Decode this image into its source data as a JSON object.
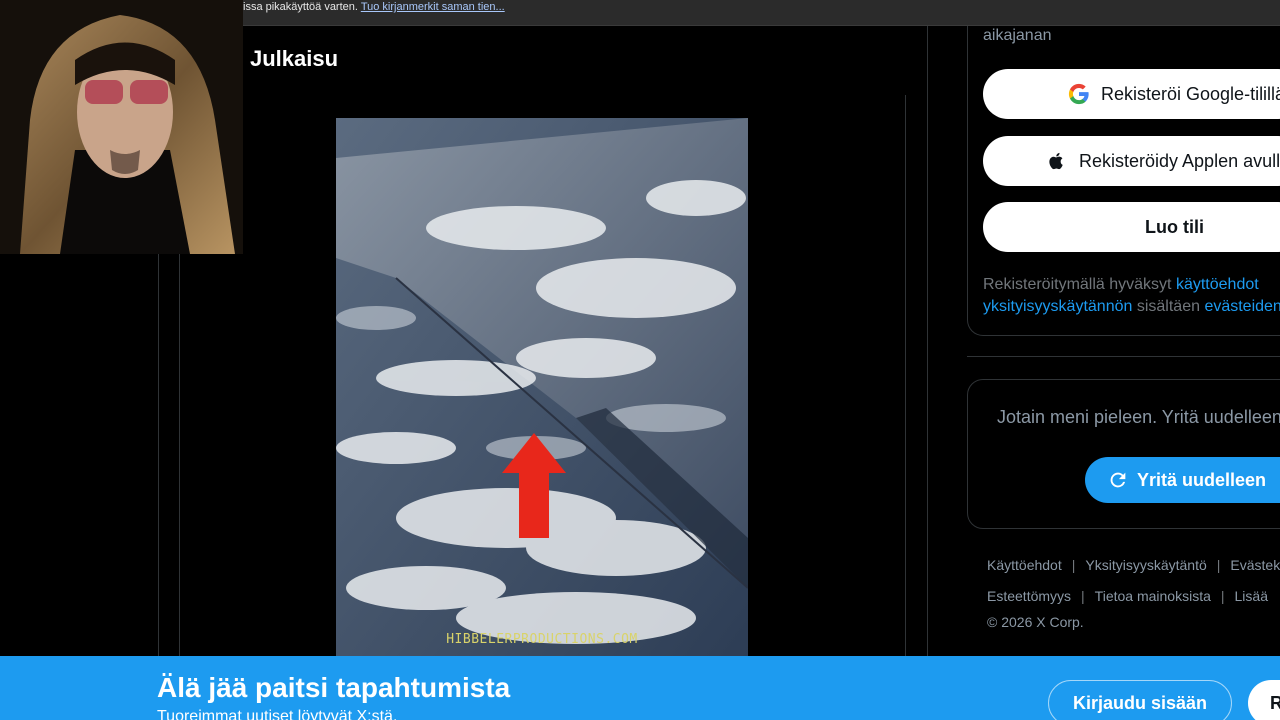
{
  "bookmark_bar": {
    "text": "issa pikakäyttöä varten. ",
    "link": "Tuo kirjanmerkit saman tien..."
  },
  "post": {
    "title": "Julkaisu",
    "media_watermark": "HIBBELERPRODUCTIONS.COM"
  },
  "sidebar": {
    "timeline_fragment": "aikajanan",
    "google_button": "Rekisteröi Google-tilillä",
    "apple_button": "Rekisteröidy Applen avulla",
    "create_account_button": "Luo tili",
    "terms": {
      "prefix": "Rekisteröitymällä hyväksyt ",
      "terms_link": "käyttöehdot",
      "line2_link": "yksityisyyskäytännön",
      "line2_middle": " sisältäen ",
      "cookies_link": "evästeiden käytön."
    },
    "error_message": "Jotain meni pieleen. Yritä uudelleen.",
    "retry_button": "Yritä uudelleen"
  },
  "footer": {
    "links_row1": [
      "Käyttöehdot",
      "Yksityisyyskäytäntö",
      "Evästekäytäntö"
    ],
    "links_row2": [
      "Esteettömyys",
      "Tietoa mainoksista",
      "Lisää"
    ],
    "copyright": "© 2026 X Corp."
  },
  "banner": {
    "title": "Älä jää paitsi tapahtumista",
    "subtitle": "Tuoreimmat uutiset löytyvät X:stä.",
    "login_button": "Kirjaudu sisään",
    "signup_button": "Rekisteröidy"
  },
  "colors": {
    "accent": "#1d9bf0",
    "background": "#000000",
    "border": "#2f3336",
    "arrow": "#e8271b"
  }
}
